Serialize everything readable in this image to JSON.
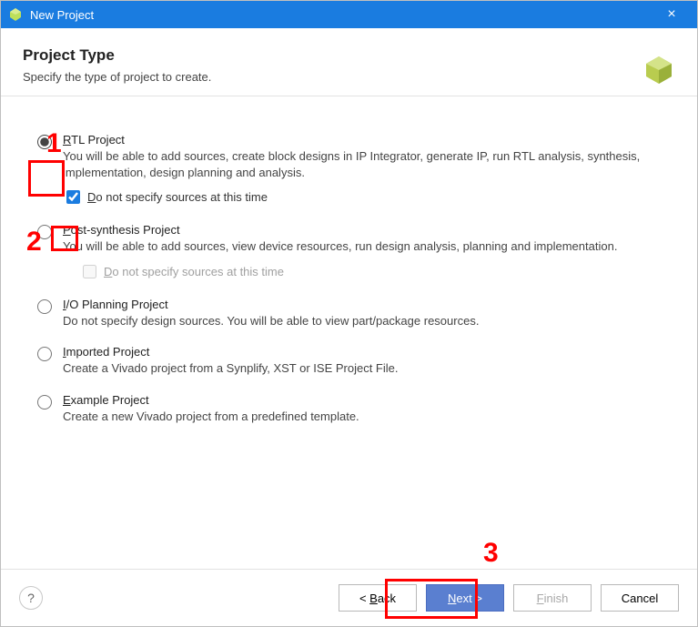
{
  "window": {
    "title": "New Project"
  },
  "header": {
    "title": "Project Type",
    "subtitle": "Specify the type of project to create."
  },
  "options": {
    "rtl": {
      "mnemonic": "R",
      "title_rest": "TL Project",
      "desc": "You will be able to add sources, create block designs in IP Integrator, generate IP, run RTL analysis, synthesis, implementation, design planning and analysis.",
      "sub_mnemonic": "D",
      "sub_rest": "o not specify sources at this time"
    },
    "post": {
      "mnemonic": "P",
      "title_rest": "ost-synthesis Project",
      "desc": "You will be able to add sources, view device resources, run design analysis, planning and implementation.",
      "sub_mnemonic": "D",
      "sub_rest": "o not specify sources at this time"
    },
    "io": {
      "mnemonic": "I",
      "title_rest": "/O Planning Project",
      "desc": "Do not specify design sources. You will be able to view part/package resources."
    },
    "imported": {
      "mnemonic": "I",
      "title_rest": "mported Project",
      "desc": "Create a Vivado project from a Synplify, XST or ISE Project File."
    },
    "example": {
      "mnemonic": "E",
      "title_rest": "xample Project",
      "desc": "Create a new Vivado project from a predefined template."
    }
  },
  "footer": {
    "help": "?",
    "back_pre": "< ",
    "back_m": "B",
    "back_rest": "ack",
    "next_m": "N",
    "next_rest": "ext >",
    "finish_m": "F",
    "finish_rest": "inish",
    "cancel": "Cancel"
  },
  "annotations": {
    "n1": "1",
    "n2": "2",
    "n3": "3"
  }
}
